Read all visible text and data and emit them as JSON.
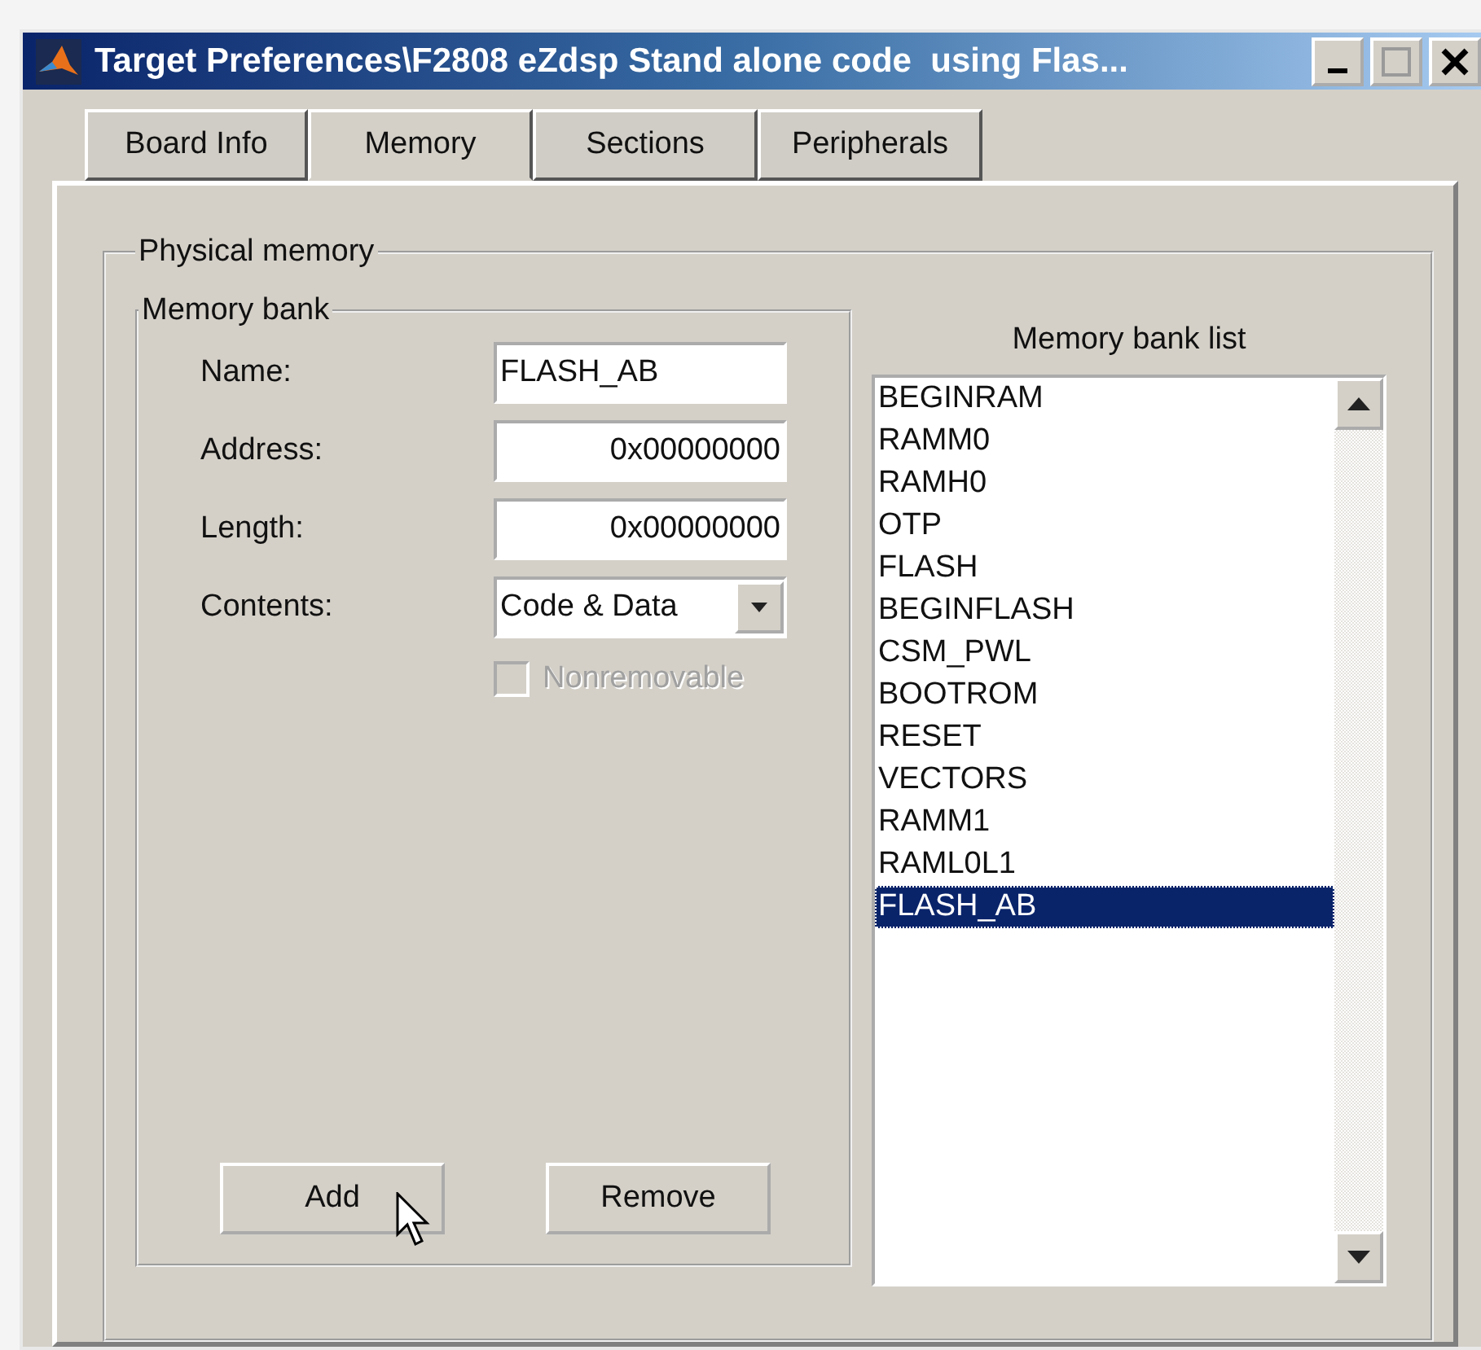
{
  "window": {
    "title": "Target Preferences\\F2808 eZdsp Stand alone code  using Flas..."
  },
  "tabs": [
    {
      "label": "Board Info",
      "selected": false
    },
    {
      "label": "Memory",
      "selected": true
    },
    {
      "label": "Sections",
      "selected": false
    },
    {
      "label": "Peripherals",
      "selected": false
    }
  ],
  "physical_memory": {
    "title": "Physical memory",
    "memory_bank": {
      "title": "Memory bank",
      "fields": [
        {
          "label": "Name:",
          "kind": "text",
          "value": "FLASH_AB"
        },
        {
          "label": "Address:",
          "kind": "number",
          "value": "0x00000000"
        },
        {
          "label": "Length:",
          "kind": "number",
          "value": "0x00000000"
        },
        {
          "label": "Contents:",
          "kind": "dropdown",
          "value": "Code & Data"
        }
      ],
      "checkbox": {
        "label": "Nonremovable",
        "checked": false,
        "disabled": true
      },
      "buttons": [
        "Add",
        "Remove"
      ]
    },
    "memory_bank_list": {
      "title": "Memory bank list",
      "items": [
        {
          "label": "BEGINRAM",
          "selected": false
        },
        {
          "label": "RAMM0",
          "selected": false
        },
        {
          "label": "RAMH0",
          "selected": false
        },
        {
          "label": "OTP",
          "selected": false
        },
        {
          "label": "FLASH",
          "selected": false
        },
        {
          "label": "BEGINFLASH",
          "selected": false
        },
        {
          "label": "CSM_PWL",
          "selected": false
        },
        {
          "label": "BOOTROM",
          "selected": false
        },
        {
          "label": "RESET",
          "selected": false
        },
        {
          "label": "VECTORS",
          "selected": false
        },
        {
          "label": "RAMM1",
          "selected": false
        },
        {
          "label": "RAML0L1",
          "selected": false
        },
        {
          "label": "FLASH_AB",
          "selected": true
        }
      ]
    }
  }
}
